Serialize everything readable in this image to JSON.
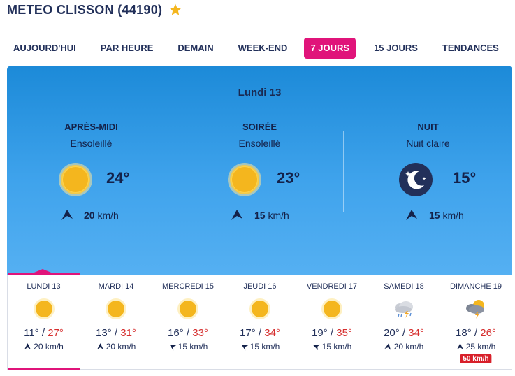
{
  "header": {
    "title": "METEO CLISSON (44190)",
    "favorite_icon": "star-icon"
  },
  "tabs": [
    {
      "label": "AUJOURD'HUI",
      "active": false
    },
    {
      "label": "PAR HEURE",
      "active": false
    },
    {
      "label": "DEMAIN",
      "active": false
    },
    {
      "label": "WEEK-END",
      "active": false
    },
    {
      "label": "7 JOURS",
      "active": true
    },
    {
      "label": "15 JOURS",
      "active": false
    },
    {
      "label": "TENDANCES",
      "active": false
    }
  ],
  "hero": {
    "day": "Lundi 13",
    "periods": [
      {
        "name": "APRÈS-MIDI",
        "condition": "Ensoleillé",
        "temp": "24°",
        "icon": "sun-icon",
        "wind_speed": "20",
        "wind_unit": "km/h"
      },
      {
        "name": "SOIRÉE",
        "condition": "Ensoleillé",
        "temp": "23°",
        "icon": "sun-icon",
        "wind_speed": "15",
        "wind_unit": "km/h"
      },
      {
        "name": "NUIT",
        "condition": "Nuit claire",
        "temp": "15°",
        "icon": "moon-stars-icon",
        "wind_speed": "15",
        "wind_unit": "km/h"
      }
    ]
  },
  "days": [
    {
      "name": "LUNDI 13",
      "icon": "sun-icon",
      "tmin": "11°",
      "tmax": "27°",
      "wind": "20",
      "unit": "km/h",
      "gust": ""
    },
    {
      "name": "MARDI 14",
      "icon": "sun-icon",
      "tmin": "13°",
      "tmax": "31°",
      "wind": "20",
      "unit": "km/h",
      "gust": ""
    },
    {
      "name": "MERCREDI 15",
      "icon": "sun-icon",
      "tmin": "16°",
      "tmax": "33°",
      "wind": "15",
      "unit": "km/h",
      "gust": ""
    },
    {
      "name": "JEUDI 16",
      "icon": "sun-icon",
      "tmin": "17°",
      "tmax": "34°",
      "wind": "15",
      "unit": "km/h",
      "gust": ""
    },
    {
      "name": "VENDREDI 17",
      "icon": "sun-icon",
      "tmin": "19°",
      "tmax": "35°",
      "wind": "15",
      "unit": "km/h",
      "gust": ""
    },
    {
      "name": "SAMEDI 18",
      "icon": "storm-cloud-icon",
      "tmin": "20°",
      "tmax": "34°",
      "wind": "20",
      "unit": "km/h",
      "gust": ""
    },
    {
      "name": "DIMANCHE 19",
      "icon": "sun-storm-cloud-icon",
      "tmin": "18°",
      "tmax": "26°",
      "wind": "25",
      "unit": "km/h",
      "gust": "50 km/h"
    }
  ],
  "slash": "/",
  "colors": {
    "accent": "#e0147a",
    "hero_top": "#1c8ad8",
    "hero_bottom": "#55b0f2",
    "max_temp": "#d62f2f",
    "gust": "#d8202a",
    "sun": "#f4b61e"
  }
}
